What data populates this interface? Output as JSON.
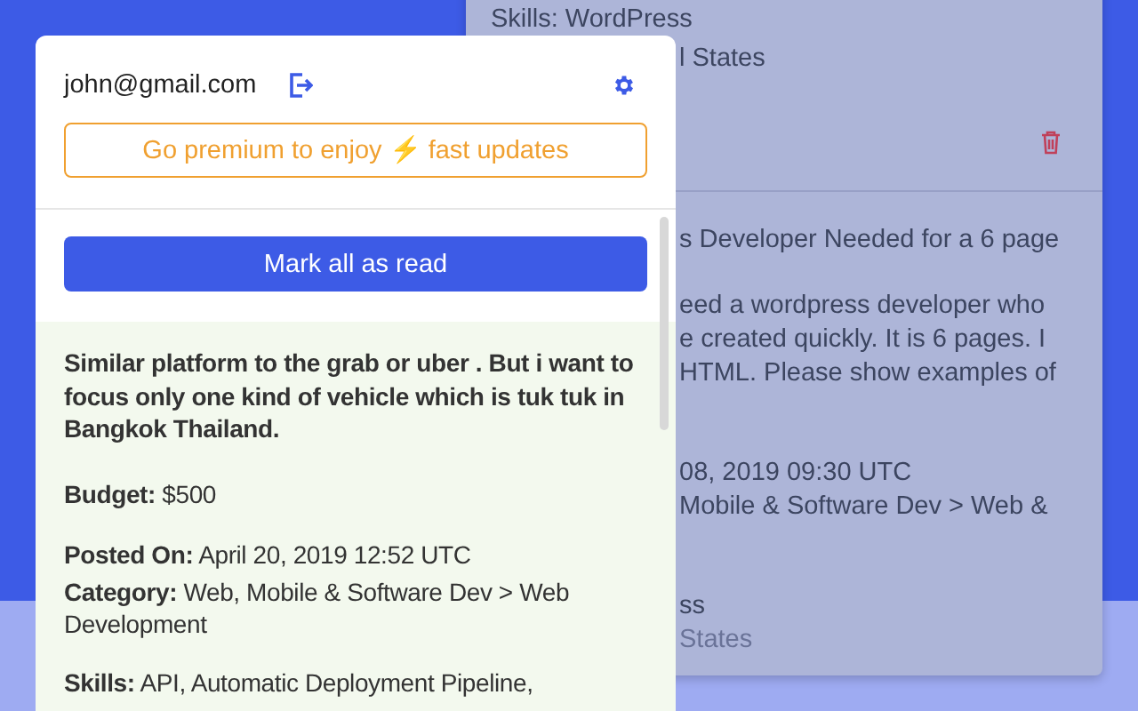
{
  "background_card": {
    "blocks": [
      {
        "lines": [
          "Skills: WordPress"
        ]
      },
      {
        "lines": [
          "l States"
        ]
      },
      {
        "lines": [
          "s Developer Needed for a 6 page"
        ]
      },
      {
        "lines": [
          "eed a wordpress developer who",
          "e created quickly. It is 6 pages. I",
          "HTML. Please show examples of"
        ]
      },
      {
        "lines": [
          "08, 2019 09:30 UTC",
          "Mobile & Software Dev > Web &"
        ]
      },
      {
        "lines": [
          "ss",
          "States"
        ]
      }
    ]
  },
  "popup": {
    "email": "john@gmail.com",
    "premium_text": "Go premium to enjoy ⚡ fast updates",
    "mark_all_button": "Mark all as read",
    "job": {
      "description": "Similar platform to the grab or uber . But i want to focus only one kind of vehicle which is tuk tuk in Bangkok Thailand.",
      "details": [
        "**Budget:** $500",
        "**Posted On:** April 20, 2019 12:52 UTC",
        "**Category:** Web, Mobile & Software Dev > Web Development",
        "**Skills:** API, Automatic Deployment Pipeline,"
      ]
    }
  }
}
